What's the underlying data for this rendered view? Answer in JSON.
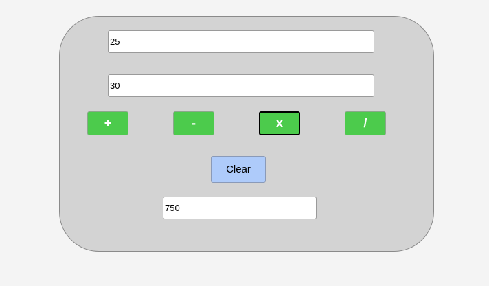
{
  "inputs": {
    "first_number": "25",
    "second_number": "30",
    "result": "750"
  },
  "operations": {
    "add": "+",
    "subtract": "-",
    "multiply": "x",
    "divide": "/"
  },
  "actions": {
    "clear_label": "Clear"
  },
  "colors": {
    "panel_background": "#d3d3d3",
    "operator_button": "#4ccb4c",
    "clear_button": "#aecbfa",
    "page_background": "#f4f4f4"
  }
}
